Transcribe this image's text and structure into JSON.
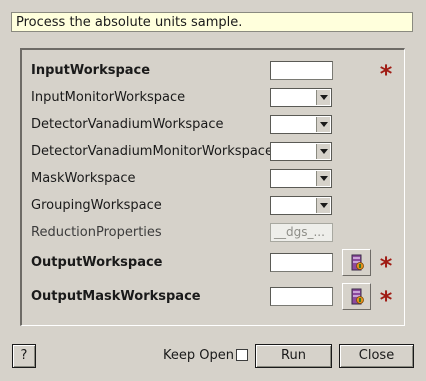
{
  "description": "Process the absolute units sample.",
  "properties": [
    {
      "label": "InputWorkspace",
      "bold": true,
      "widget": "text",
      "required": true
    },
    {
      "label": "InputMonitorWorkspace",
      "bold": false,
      "widget": "combo"
    },
    {
      "label": "DetectorVanadiumWorkspace",
      "bold": false,
      "widget": "combo"
    },
    {
      "label": "DetectorVanadiumMonitorWorkspace",
      "bold": false,
      "widget": "combo"
    },
    {
      "label": "MaskWorkspace",
      "bold": false,
      "widget": "combo"
    },
    {
      "label": "GroupingWorkspace",
      "bold": false,
      "widget": "combo"
    },
    {
      "label": "ReductionProperties",
      "bold": false,
      "widget": "disabled-text",
      "value": "__dgs_..."
    },
    {
      "label": "OutputWorkspace",
      "bold": true,
      "widget": "text-browse",
      "required": true
    },
    {
      "label": "OutputMaskWorkspace",
      "bold": true,
      "widget": "text-browse",
      "required": true
    }
  ],
  "required_marker": "*",
  "buttons": {
    "help": "?",
    "keep_open": "Keep Open",
    "keep_open_checked": false,
    "run": "Run",
    "close": "Close"
  },
  "colors": {
    "required": "#a01c14",
    "description_bg": "#ffffdc",
    "window_bg": "#d6d2ca"
  },
  "icons": {
    "browse": "workspace-browse-icon",
    "combo_arrow": "chevron-down-icon"
  }
}
